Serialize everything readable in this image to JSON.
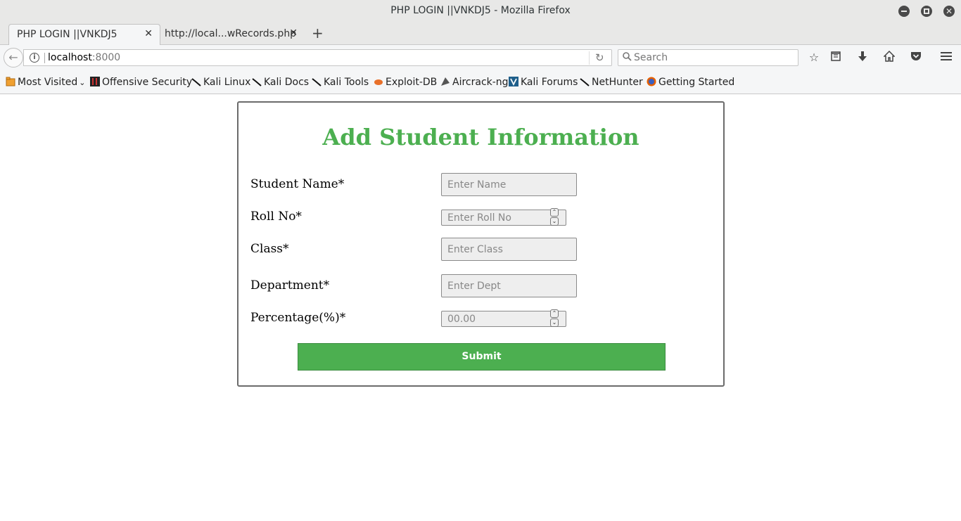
{
  "window": {
    "title": "PHP LOGIN ||VNKDJ5 - Mozilla Firefox"
  },
  "tabs": [
    {
      "label": "PHP LOGIN ||VNKDJ5",
      "active": true
    },
    {
      "label": "http://local...wRecords.php",
      "active": false
    }
  ],
  "navbar": {
    "url_host": "localhost",
    "url_port": ":8000",
    "search_placeholder": "Search"
  },
  "bookmarks": [
    {
      "label": "Most Visited",
      "icon": "folder-icon"
    },
    {
      "label": "Offensive Security",
      "icon": "offsec-icon"
    },
    {
      "label": "Kali Linux",
      "icon": "kali-icon"
    },
    {
      "label": "Kali Docs",
      "icon": "kali-icon"
    },
    {
      "label": "Kali Tools",
      "icon": "kali-icon"
    },
    {
      "label": "Exploit-DB",
      "icon": "exploitdb-icon"
    },
    {
      "label": "Aircrack-ng",
      "icon": "aircrack-icon"
    },
    {
      "label": "Kali Forums",
      "icon": "kali-forums-icon"
    },
    {
      "label": "NetHunter",
      "icon": "kali-icon"
    },
    {
      "label": "Getting Started",
      "icon": "firefox-icon"
    }
  ],
  "form": {
    "title": "Add Student Information",
    "fields": {
      "name": {
        "label": "Student Name*",
        "placeholder": "Enter Name"
      },
      "roll": {
        "label": "Roll No*",
        "placeholder": "Enter Roll No"
      },
      "class": {
        "label": "Class*",
        "placeholder": "Enter Class"
      },
      "dept": {
        "label": "Department*",
        "placeholder": "Enter Dept"
      },
      "percentage": {
        "label": "Percentage(%)*",
        "placeholder": "00.00"
      }
    },
    "submit_label": "Submit"
  },
  "colors": {
    "accent": "#4caf50",
    "border": "#6b6b6b"
  }
}
